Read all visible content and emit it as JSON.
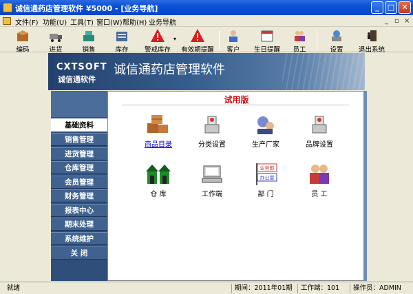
{
  "window": {
    "title": "诚信通药店管理软件 ¥5000 - [业务导航]",
    "minimize": "_",
    "maximize": "□",
    "close": "✕"
  },
  "menu": {
    "items": [
      "文件(F)",
      "功能(U)",
      "工具(T)",
      "窗口(W)",
      "帮助(H)",
      "业务导航"
    ],
    "mdi_controls": [
      "_",
      "▫",
      "×"
    ]
  },
  "toolbar": {
    "buttons": [
      {
        "label": "编码",
        "icon": "code-box-icon"
      },
      {
        "label": "进货",
        "icon": "purchase-truck-icon"
      },
      {
        "label": "销售",
        "icon": "sales-register-icon"
      },
      {
        "label": "库存",
        "icon": "inventory-icon"
      },
      {
        "label": "警戒库存",
        "icon": "warning-icon"
      },
      {
        "label": "有效期提醒",
        "icon": "warning-icon"
      },
      {
        "label": "客户",
        "icon": "customer-icon"
      },
      {
        "label": "生日提醒",
        "icon": "calendar-icon"
      },
      {
        "label": "员工",
        "icon": "staff-icon"
      },
      {
        "label": "设置",
        "icon": "settings-icon"
      },
      {
        "label": "退出系统",
        "icon": "exit-icon"
      }
    ]
  },
  "banner": {
    "en": "CXTSOFT",
    "cn": "诚信通软件",
    "title": "诚信通药店管理软件"
  },
  "sidebar": {
    "items": [
      "基础资料",
      "销售管理",
      "进货管理",
      "仓库管理",
      "会员管理",
      "财务管理",
      "报表中心",
      "期末处理",
      "系统维护",
      "关    闭"
    ],
    "active_index": 0
  },
  "content": {
    "trial_label": "试用版",
    "modules": [
      {
        "label": "商品目录",
        "icon": "product-boxes-icon"
      },
      {
        "label": "分类设置",
        "icon": "category-icon"
      },
      {
        "label": "生产厂家",
        "icon": "manufacturer-icon"
      },
      {
        "label": "品牌设置",
        "icon": "brand-icon"
      },
      {
        "label": "仓    库",
        "icon": "warehouse-icon"
      },
      {
        "label": "工作端",
        "icon": "workstation-icon"
      },
      {
        "label": "部    门",
        "icon": "department-icon"
      },
      {
        "label": "员    工",
        "icon": "employee-icon"
      }
    ],
    "department_sign": [
      "业务部",
      "办公室"
    ]
  },
  "status": {
    "left": "就绪",
    "period": "期间：2011年01期",
    "workstation": "工作端：101",
    "operator": "操作员：ADMIN"
  }
}
